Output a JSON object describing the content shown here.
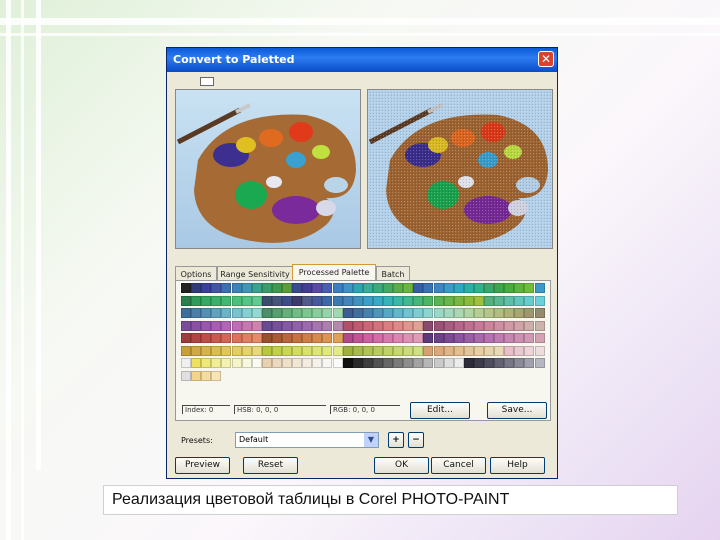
{
  "dialog": {
    "title": "Convert to Paletted",
    "close_glyph": "✕",
    "tabs": [
      "Options",
      "Range Sensitivity",
      "Processed Palette",
      "Batch"
    ],
    "active_tab": 2,
    "status": [
      "Index: 0",
      "HSB: 0, 0, 0",
      "RGB: 0, 0, 0"
    ],
    "edit_label": "Edit...",
    "save_label": "Save...",
    "presets_label": "Presets:",
    "presets_value": "Default",
    "add_preset_label": "+",
    "remove_preset_label": "−",
    "preview_label": "Preview",
    "reset_label": "Reset",
    "ok_label": "OK",
    "cancel_label": "Cancel",
    "help_label": "Help"
  },
  "palette_colors": [
    [
      "#222222",
      "#2f3b7a",
      "#3a3f9a",
      "#4256a8",
      "#3e6fb0",
      "#3e83b8",
      "#3f97b3",
      "#3aa28e",
      "#3a9d6a",
      "#3f9a4f",
      "#5a9d3b",
      "#3a4a8f",
      "#453d95",
      "#5a4aa6",
      "#4a5fb4",
      "#3d7ec2",
      "#3e93c8",
      "#2fa4b3",
      "#3eab99",
      "#3caa7e",
      "#44aa62",
      "#5aae4a",
      "#6cb63f",
      "#3560a8",
      "#3a72b6",
      "#3c86c2",
      "#3b9ac8",
      "#2ea9c0",
      "#2bb0a5",
      "#2fb38c",
      "#36a96c",
      "#3ba64f",
      "#46ad3e",
      "#5cb63e",
      "#70bd3b",
      "#3a99c9"
    ],
    [
      "#2a7f4d",
      "#2f9b5a",
      "#35a864",
      "#3bb06a",
      "#43b873",
      "#4ac07c",
      "#55c585",
      "#5fcb90",
      "#3a4d6b",
      "#46557a",
      "#3d4d8a",
      "#3c3b6a",
      "#525c8a",
      "#485a9a",
      "#3c6aa8",
      "#3d78b0",
      "#4484b8",
      "#4292c0",
      "#3b9fc8",
      "#37aac5",
      "#35b3b8",
      "#3ab8a5",
      "#3fb98e",
      "#45b878",
      "#4cb563",
      "#58b454",
      "#66b64a",
      "#78b842",
      "#8abc3c",
      "#9ec03a",
      "#56b07a",
      "#5ab890",
      "#5ec0a6",
      "#62c6ba",
      "#66cccc",
      "#6ad0de"
    ],
    [
      "#3f6e9c",
      "#4a7ea8",
      "#5590b4",
      "#61a2bf",
      "#6db3c8",
      "#79c2cf",
      "#86cfd3",
      "#92d9d4",
      "#4a8f6a",
      "#55a070",
      "#62b07a",
      "#6dbd84",
      "#7ac790",
      "#86cf9c",
      "#92d5a8",
      "#9ed9b4",
      "#3c5f92",
      "#4070a2",
      "#4682b0",
      "#4e94bc",
      "#58a6c6",
      "#64b6cd",
      "#71c3d0",
      "#7fcdd0",
      "#8cd4cd",
      "#98d8c8",
      "#a2d9be",
      "#aad8b2",
      "#b0d4a4",
      "#b4ce96",
      "#b6c68a",
      "#b4bc80",
      "#b0b078",
      "#aaa372",
      "#a2966e",
      "#98896c"
    ],
    [
      "#7a4c9a",
      "#8a50a4",
      "#9856ac",
      "#a65db2",
      "#b265b5",
      "#bd6eb5",
      "#c678b2",
      "#ce82ad",
      "#6a4a90",
      "#78509a",
      "#8558a2",
      "#9160a8",
      "#9c6aac",
      "#a674ae",
      "#ae7eae",
      "#b588ac",
      "#b0506a",
      "#c05a70",
      "#cc6676",
      "#d4727c",
      "#da7e82",
      "#de8a88",
      "#e0968e",
      "#e0a294",
      "#8a4a6e",
      "#9a5278",
      "#a85c82",
      "#b4668a",
      "#be7092",
      "#c67a98",
      "#cc849e",
      "#d08ea2",
      "#d298a6",
      "#d2a2a8",
      "#d0acaa",
      "#ccb4ac"
    ],
    [
      "#a03c3c",
      "#b04444",
      "#be4e4a",
      "#ca5a50",
      "#d46656",
      "#dc725c",
      "#e27e62",
      "#e68a68",
      "#9a5030",
      "#aa5a34",
      "#b8663a",
      "#c47240",
      "#ce7e46",
      "#d68a4c",
      "#dc9652",
      "#e0a258",
      "#b04a8a",
      "#c05496",
      "#cc60a0",
      "#d46ca8",
      "#da78ae",
      "#de84b2",
      "#e090b4",
      "#e09cb6",
      "#5a3a7a",
      "#6a4288",
      "#7a4a94",
      "#8a549e",
      "#9a5ea6",
      "#a868ac",
      "#b472b0",
      "#be7cb2",
      "#c686b2",
      "#cc90b2",
      "#d09ab2",
      "#d2a4b2"
    ],
    [
      "#c8a03a",
      "#d0aa40",
      "#d6b446",
      "#dcbe4e",
      "#e0c656",
      "#e4ce60",
      "#e6d46a",
      "#e8da76",
      "#b8c83a",
      "#c2d044",
      "#cad84e",
      "#d2de5a",
      "#d8e266",
      "#dce672",
      "#e0e87e",
      "#e2ea8a",
      "#a0b040",
      "#a8ba48",
      "#b0c452",
      "#b8cc5c",
      "#c0d266",
      "#c6d870",
      "#ccdc7a",
      "#d0e084",
      "#d6a070",
      "#dcaa7a",
      "#e0b484",
      "#e4be8e",
      "#e6c698",
      "#e8cea2",
      "#e8d4ac",
      "#e8dab6",
      "#e8c0c8",
      "#eacad0",
      "#ecd4d8",
      "#eedde0"
    ],
    [
      "#f0f0f0",
      "#f0e060",
      "#f0e87a",
      "#f2ee96",
      "#f4f2b0",
      "#f6f5c8",
      "#f8f8dc",
      "#fafaf0",
      "#e8d0b0",
      "#ecd8bc",
      "#f0e0c8",
      "#f2e6d4",
      "#f4ece0",
      "#f6f2ea",
      "#f8f6f2",
      "#fafafa",
      "#101010",
      "#2a2a2a",
      "#3e3e3e",
      "#525252",
      "#666666",
      "#7a7a7a",
      "#8e8e8e",
      "#a2a2a2",
      "#b6b6b6",
      "#cacaca",
      "#dedede",
      "#ececec",
      "#2c2c3a",
      "#3c3c4c",
      "#4e4e5e",
      "#626272",
      "#767686",
      "#8a8a9a",
      "#a0a0ae",
      "#b6b6c2"
    ],
    [
      "#e0e0e0",
      "#f4d48a",
      "#f6dca0",
      "#f8e4b6"
    ]
  ],
  "caption": "Реализация цветовой таблицы в Corel PHOTO-PAINT"
}
